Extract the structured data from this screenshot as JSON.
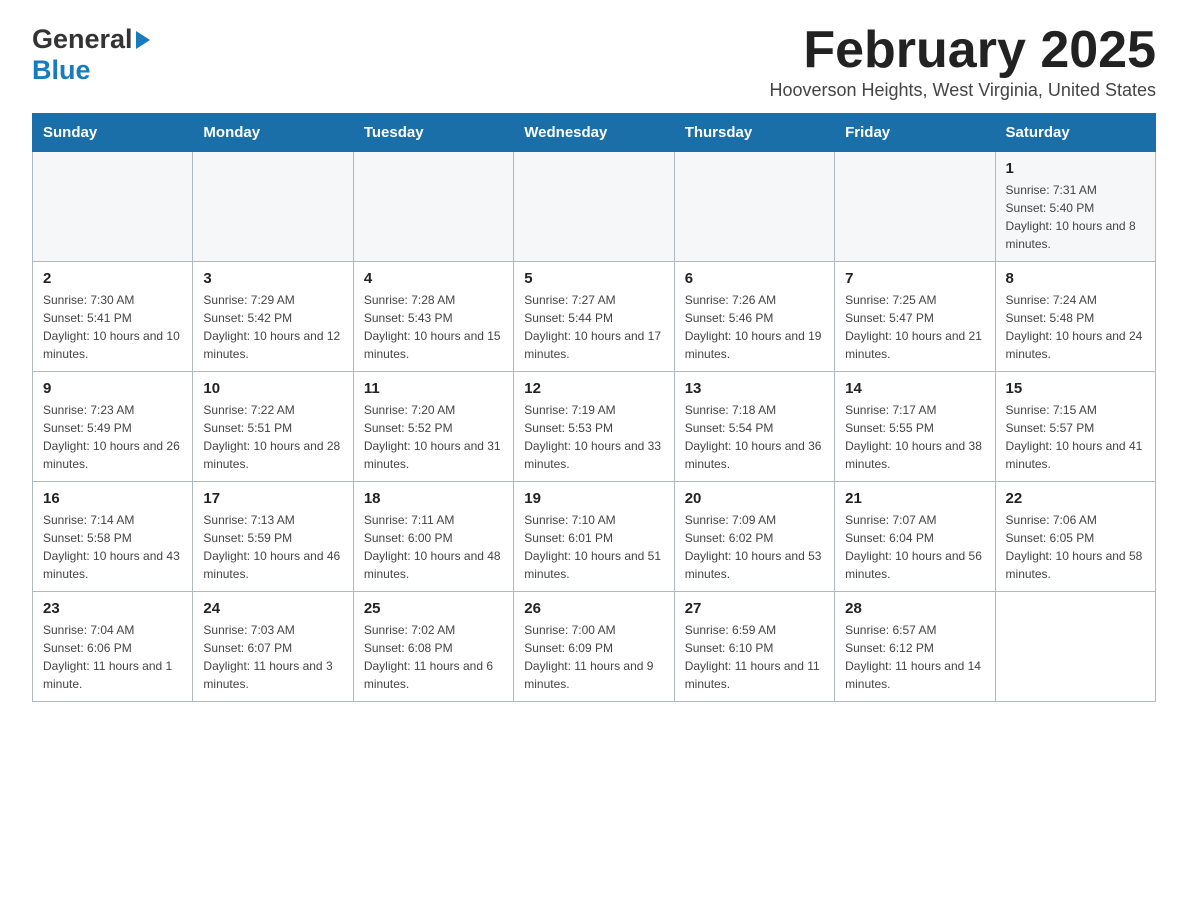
{
  "logo": {
    "line1": "General",
    "line2": "Blue"
  },
  "header": {
    "month_year": "February 2025",
    "location": "Hooverson Heights, West Virginia, United States"
  },
  "days_of_week": [
    "Sunday",
    "Monday",
    "Tuesday",
    "Wednesday",
    "Thursday",
    "Friday",
    "Saturday"
  ],
  "weeks": [
    [
      {
        "day": "",
        "info": ""
      },
      {
        "day": "",
        "info": ""
      },
      {
        "day": "",
        "info": ""
      },
      {
        "day": "",
        "info": ""
      },
      {
        "day": "",
        "info": ""
      },
      {
        "day": "",
        "info": ""
      },
      {
        "day": "1",
        "info": "Sunrise: 7:31 AM\nSunset: 5:40 PM\nDaylight: 10 hours and 8 minutes."
      }
    ],
    [
      {
        "day": "2",
        "info": "Sunrise: 7:30 AM\nSunset: 5:41 PM\nDaylight: 10 hours and 10 minutes."
      },
      {
        "day": "3",
        "info": "Sunrise: 7:29 AM\nSunset: 5:42 PM\nDaylight: 10 hours and 12 minutes."
      },
      {
        "day": "4",
        "info": "Sunrise: 7:28 AM\nSunset: 5:43 PM\nDaylight: 10 hours and 15 minutes."
      },
      {
        "day": "5",
        "info": "Sunrise: 7:27 AM\nSunset: 5:44 PM\nDaylight: 10 hours and 17 minutes."
      },
      {
        "day": "6",
        "info": "Sunrise: 7:26 AM\nSunset: 5:46 PM\nDaylight: 10 hours and 19 minutes."
      },
      {
        "day": "7",
        "info": "Sunrise: 7:25 AM\nSunset: 5:47 PM\nDaylight: 10 hours and 21 minutes."
      },
      {
        "day": "8",
        "info": "Sunrise: 7:24 AM\nSunset: 5:48 PM\nDaylight: 10 hours and 24 minutes."
      }
    ],
    [
      {
        "day": "9",
        "info": "Sunrise: 7:23 AM\nSunset: 5:49 PM\nDaylight: 10 hours and 26 minutes."
      },
      {
        "day": "10",
        "info": "Sunrise: 7:22 AM\nSunset: 5:51 PM\nDaylight: 10 hours and 28 minutes."
      },
      {
        "day": "11",
        "info": "Sunrise: 7:20 AM\nSunset: 5:52 PM\nDaylight: 10 hours and 31 minutes."
      },
      {
        "day": "12",
        "info": "Sunrise: 7:19 AM\nSunset: 5:53 PM\nDaylight: 10 hours and 33 minutes."
      },
      {
        "day": "13",
        "info": "Sunrise: 7:18 AM\nSunset: 5:54 PM\nDaylight: 10 hours and 36 minutes."
      },
      {
        "day": "14",
        "info": "Sunrise: 7:17 AM\nSunset: 5:55 PM\nDaylight: 10 hours and 38 minutes."
      },
      {
        "day": "15",
        "info": "Sunrise: 7:15 AM\nSunset: 5:57 PM\nDaylight: 10 hours and 41 minutes."
      }
    ],
    [
      {
        "day": "16",
        "info": "Sunrise: 7:14 AM\nSunset: 5:58 PM\nDaylight: 10 hours and 43 minutes."
      },
      {
        "day": "17",
        "info": "Sunrise: 7:13 AM\nSunset: 5:59 PM\nDaylight: 10 hours and 46 minutes."
      },
      {
        "day": "18",
        "info": "Sunrise: 7:11 AM\nSunset: 6:00 PM\nDaylight: 10 hours and 48 minutes."
      },
      {
        "day": "19",
        "info": "Sunrise: 7:10 AM\nSunset: 6:01 PM\nDaylight: 10 hours and 51 minutes."
      },
      {
        "day": "20",
        "info": "Sunrise: 7:09 AM\nSunset: 6:02 PM\nDaylight: 10 hours and 53 minutes."
      },
      {
        "day": "21",
        "info": "Sunrise: 7:07 AM\nSunset: 6:04 PM\nDaylight: 10 hours and 56 minutes."
      },
      {
        "day": "22",
        "info": "Sunrise: 7:06 AM\nSunset: 6:05 PM\nDaylight: 10 hours and 58 minutes."
      }
    ],
    [
      {
        "day": "23",
        "info": "Sunrise: 7:04 AM\nSunset: 6:06 PM\nDaylight: 11 hours and 1 minute."
      },
      {
        "day": "24",
        "info": "Sunrise: 7:03 AM\nSunset: 6:07 PM\nDaylight: 11 hours and 3 minutes."
      },
      {
        "day": "25",
        "info": "Sunrise: 7:02 AM\nSunset: 6:08 PM\nDaylight: 11 hours and 6 minutes."
      },
      {
        "day": "26",
        "info": "Sunrise: 7:00 AM\nSunset: 6:09 PM\nDaylight: 11 hours and 9 minutes."
      },
      {
        "day": "27",
        "info": "Sunrise: 6:59 AM\nSunset: 6:10 PM\nDaylight: 11 hours and 11 minutes."
      },
      {
        "day": "28",
        "info": "Sunrise: 6:57 AM\nSunset: 6:12 PM\nDaylight: 11 hours and 14 minutes."
      },
      {
        "day": "",
        "info": ""
      }
    ]
  ]
}
